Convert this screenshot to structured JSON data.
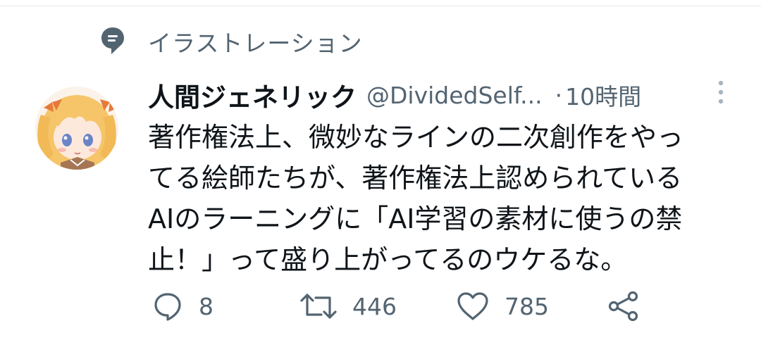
{
  "context": {
    "icon": "topic-icon",
    "label": "イラストレーション"
  },
  "tweet": {
    "display_name": "人間ジェネリック",
    "handle": "@DividedSelf...",
    "separator": "·",
    "time": "10時間",
    "text_lines": [
      "著作権法上、微妙なラインの二次創作をやっ",
      "てる絵師たちが、著作権法上認められている",
      "AIのラーニングに「AI学習の素材に使うの禁",
      "止！」って盛り上がってるのウケるな。"
    ]
  },
  "actions": {
    "reply_count": "8",
    "retweet_count": "446",
    "like_count": "785"
  },
  "colors": {
    "text_primary": "#0f1419",
    "text_secondary": "#536471",
    "icon": "#536471"
  }
}
